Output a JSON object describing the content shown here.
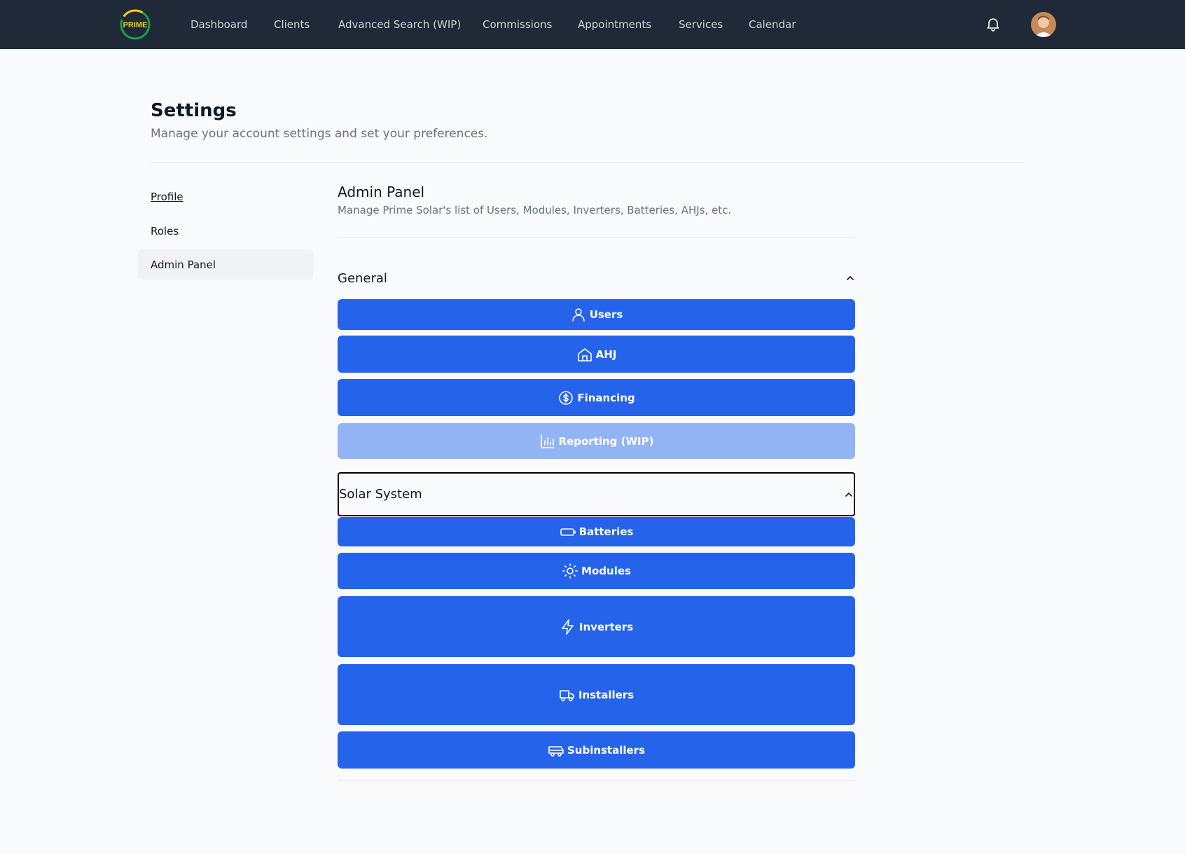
{
  "nav": {
    "logo_text": "PRIME",
    "items": [
      {
        "label": "Dashboard"
      },
      {
        "label": "Clients"
      },
      {
        "label": "Advanced Search (WIP)"
      },
      {
        "label": "Commissions"
      },
      {
        "label": "Appointments"
      },
      {
        "label": "Services"
      },
      {
        "label": "Calendar"
      }
    ]
  },
  "settings": {
    "title": "Settings",
    "subtitle": "Manage your account settings and set your preferences."
  },
  "sidebar": {
    "items": [
      {
        "label": "Profile"
      },
      {
        "label": "Roles"
      },
      {
        "label": "Admin Panel",
        "active": true
      }
    ]
  },
  "admin": {
    "title": "Admin Panel",
    "subtitle": "Manage Prime Solar's list of Users, Modules, Inverters, Batteries, AHJs, etc."
  },
  "sections": [
    {
      "label": "General",
      "buttons": [
        {
          "label": "Users",
          "icon": "user-icon"
        },
        {
          "label": "AHJ",
          "icon": "home-icon"
        },
        {
          "label": "Financing",
          "icon": "dollar-circle-icon"
        },
        {
          "label": "Reporting (WIP)",
          "icon": "bar-chart-icon",
          "disabled": true
        }
      ]
    },
    {
      "label": "Solar System",
      "buttons": [
        {
          "label": "Batteries",
          "icon": "battery-icon"
        },
        {
          "label": "Modules",
          "icon": "sun-icon"
        },
        {
          "label": "Inverters",
          "icon": "bolt-icon"
        },
        {
          "label": "Installers",
          "icon": "truck-icon"
        },
        {
          "label": "Subinstallers",
          "icon": "van-icon"
        }
      ]
    }
  ],
  "colors": {
    "nav_bg": "#1f2937",
    "button_primary": "#2563eb",
    "button_disabled": "#93b4f4",
    "page_bg": "#f9fafb"
  }
}
